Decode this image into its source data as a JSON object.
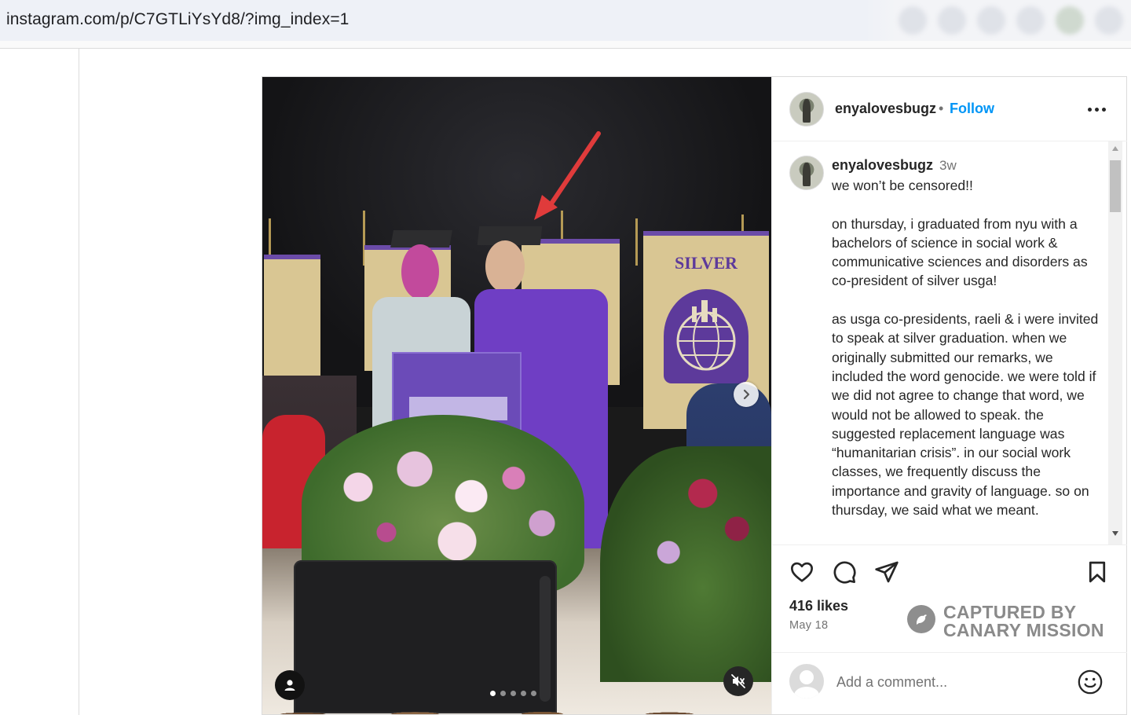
{
  "browser": {
    "url": "instagram.com/p/C7GTLiYsYd8/?img_index=1"
  },
  "post": {
    "header": {
      "username": "enyalovesbugz",
      "separator": "•",
      "follow_label": "Follow",
      "more_icon": "more-horizontal-icon"
    },
    "caption": {
      "username": "enyalovesbugz",
      "time_ago": "3w",
      "text": "we won’t be censored!!\n\non thursday, i graduated from nyu with a bachelors of science in social work & communicative sciences and disorders as co-president of silver usga!\n\nas usga co-presidents, raeli & i were invited to speak at silver graduation. when we originally submitted our remarks, we included the word genocide. we were told if we did not agree to change that word, we would not be allowed to speak. the suggested replacement language was “humanitarian crisis”. in our social work classes, we frequently discuss the importance and gravity of language. so on thursday, we said what we meant."
    },
    "media": {
      "banner_text": "SILVER",
      "carousel_count": 5,
      "carousel_active_index": 0,
      "annotation": "red-arrow"
    },
    "likes": "416 likes",
    "date": "May 18",
    "watermark": {
      "line1": "CAPTURED BY",
      "line2": "CANARY MISSION"
    },
    "comment": {
      "placeholder": "Add a comment..."
    }
  },
  "colors": {
    "accent": "#0095f6",
    "text": "#262626",
    "muted": "#737373",
    "border": "#dbdbdb",
    "arrow": "#e03b3b"
  }
}
